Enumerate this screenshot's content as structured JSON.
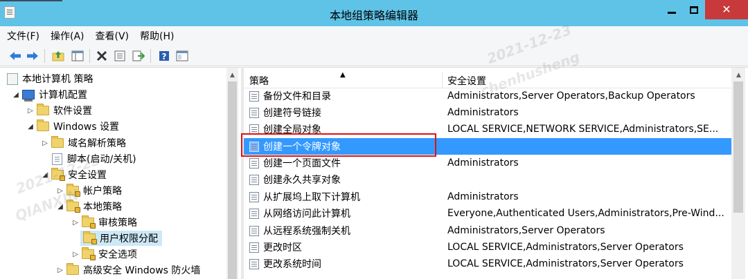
{
  "window": {
    "title": "本地组策略编辑器",
    "minimize_glyph": "—",
    "maximize_glyph": "□",
    "close_glyph": "✕"
  },
  "menu": [
    "文件(F)",
    "操作(A)",
    "查看(V)",
    "帮助(H)"
  ],
  "toolbar": {
    "icons": [
      "back-icon",
      "forward-icon",
      "up-folder-icon",
      "show-hide-tree-icon",
      "delete-icon",
      "properties-icon",
      "export-list-icon",
      "help-icon",
      "view-icon"
    ]
  },
  "tree": {
    "root": "本地计算机 策略",
    "computer_config": "计算机配置",
    "software_settings": "软件设置",
    "windows_settings": "Windows 设置",
    "name_resolution": "域名解析策略",
    "scripts": "脚本(启动/关机)",
    "security_settings": "安全设置",
    "account_policies": "帐户策略",
    "local_policies": "本地策略",
    "audit_policy": "审核策略",
    "user_rights": "用户权限分配",
    "security_options": "安全选项",
    "firewall": "高级安全 Windows 防火墙"
  },
  "list": {
    "col_policy": "策略",
    "col_security": "安全设置",
    "rows": [
      {
        "name": "备份文件和目录",
        "setting": "Administrators,Server Operators,Backup Operators"
      },
      {
        "name": "创建符号链接",
        "setting": "Administrators"
      },
      {
        "name": "创建全局对象",
        "setting": "LOCAL SERVICE,NETWORK SERVICE,Administrators,SE..."
      },
      {
        "name": "创建一个令牌对象",
        "setting": ""
      },
      {
        "name": "创建一个页面文件",
        "setting": "Administrators"
      },
      {
        "name": "创建永久共享对象",
        "setting": ""
      },
      {
        "name": "从扩展坞上取下计算机",
        "setting": "Administrators"
      },
      {
        "name": "从网络访问此计算机",
        "setting": "Everyone,Authenticated Users,Administrators,Pre-Wind..."
      },
      {
        "name": "从远程系统强制关机",
        "setting": "Administrators,Server Operators"
      },
      {
        "name": "更改时区",
        "setting": "LOCAL SERVICE,Administrators,Server Operators"
      },
      {
        "name": "更改系统时间",
        "setting": "LOCAL SERVICE,Administrators,Server Operators"
      }
    ],
    "selected_index": 3
  },
  "watermark": {
    "date": "2021-12-23",
    "user": "chenhusheng",
    "org": "QIANXIN"
  },
  "colors": {
    "titlebar": "#5fc3e8",
    "close_button": "#c7393b",
    "selection": "#3399ff",
    "highlight_box": "#e01010"
  }
}
